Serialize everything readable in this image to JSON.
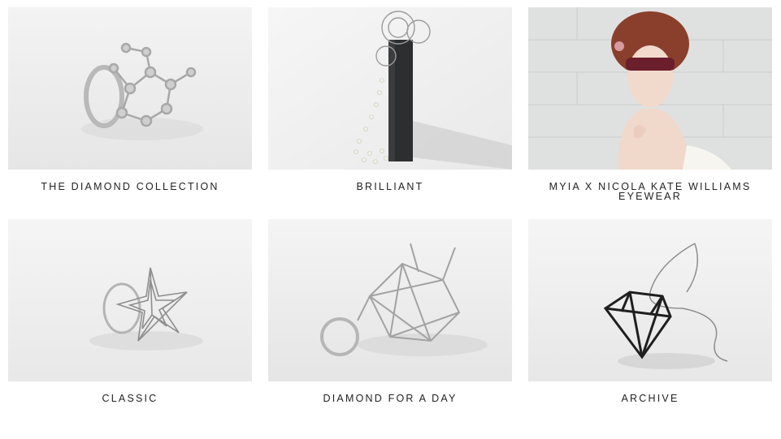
{
  "collections": [
    {
      "title": "THE DIAMOND COLLECTION",
      "image_alt": "molecular-ring-photo"
    },
    {
      "title": "BRILLIANT",
      "image_alt": "filigree-pearl-necklace-photo"
    },
    {
      "title": "MYIA X NICOLA KATE WILLIAMS EYEWEAR",
      "image_alt": "model-lace-eyewear-photo"
    },
    {
      "title": "CLASSIC",
      "image_alt": "star-ring-photo"
    },
    {
      "title": "DIAMOND FOR A DAY",
      "image_alt": "wireframe-diamond-ring-photo"
    },
    {
      "title": "ARCHIVE",
      "image_alt": "black-diamond-pendant-photo"
    }
  ],
  "colors": {
    "caption_text": "#222222",
    "background": "#ffffff"
  }
}
